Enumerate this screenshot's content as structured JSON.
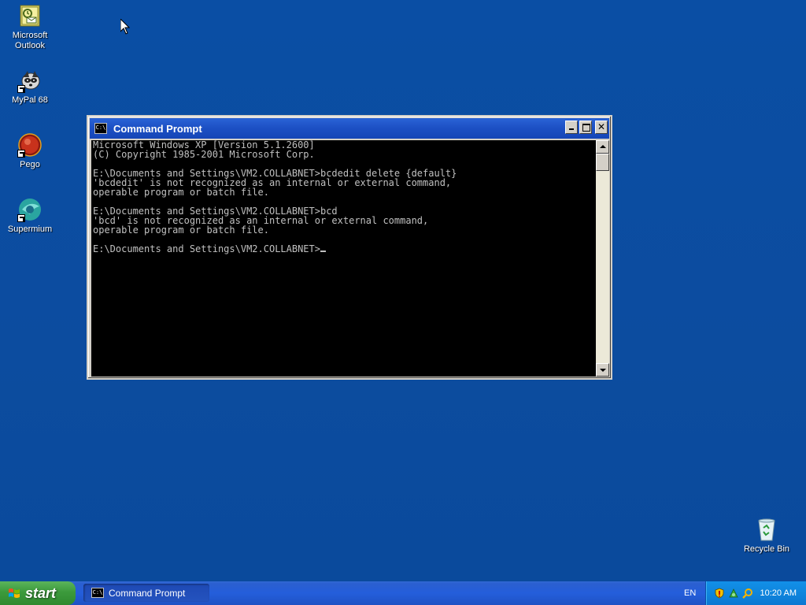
{
  "desktop": {
    "icons": [
      {
        "label": "Microsoft Outlook",
        "icon": "outlook-icon"
      },
      {
        "label": "MyPal 68",
        "icon": "mypal-icon"
      },
      {
        "label": "Pego",
        "icon": "pego-icon"
      },
      {
        "label": "Supermium",
        "icon": "supermium-icon"
      },
      {
        "label": "Recycle Bin",
        "icon": "recycle-bin-icon"
      }
    ]
  },
  "window": {
    "title": "Command Prompt",
    "icon_text": "C:\\",
    "console_lines": [
      "Microsoft Windows XP [Version 5.1.2600]",
      "(C) Copyright 1985-2001 Microsoft Corp.",
      "",
      "E:\\Documents and Settings\\VM2.COLLABNET>bcdedit delete {default}",
      "'bcdedit' is not recognized as an internal or external command,",
      "operable program or batch file.",
      "",
      "E:\\Documents and Settings\\VM2.COLLABNET>bcd",
      "'bcd' is not recognized as an internal or external command,",
      "operable program or batch file.",
      "",
      "E:\\Documents and Settings\\VM2.COLLABNET>"
    ]
  },
  "taskbar": {
    "start_label": "start",
    "task_label": "Command Prompt",
    "language": "EN",
    "clock": "10:20 AM"
  },
  "colors": {
    "desktop_bg": "#0b4da1",
    "console_bg": "#000000",
    "console_fg": "#c0c0c0",
    "titlebar": "#1c4fc3",
    "start_green": "#3c9a3c",
    "tray_blue": "#0f85dd"
  }
}
